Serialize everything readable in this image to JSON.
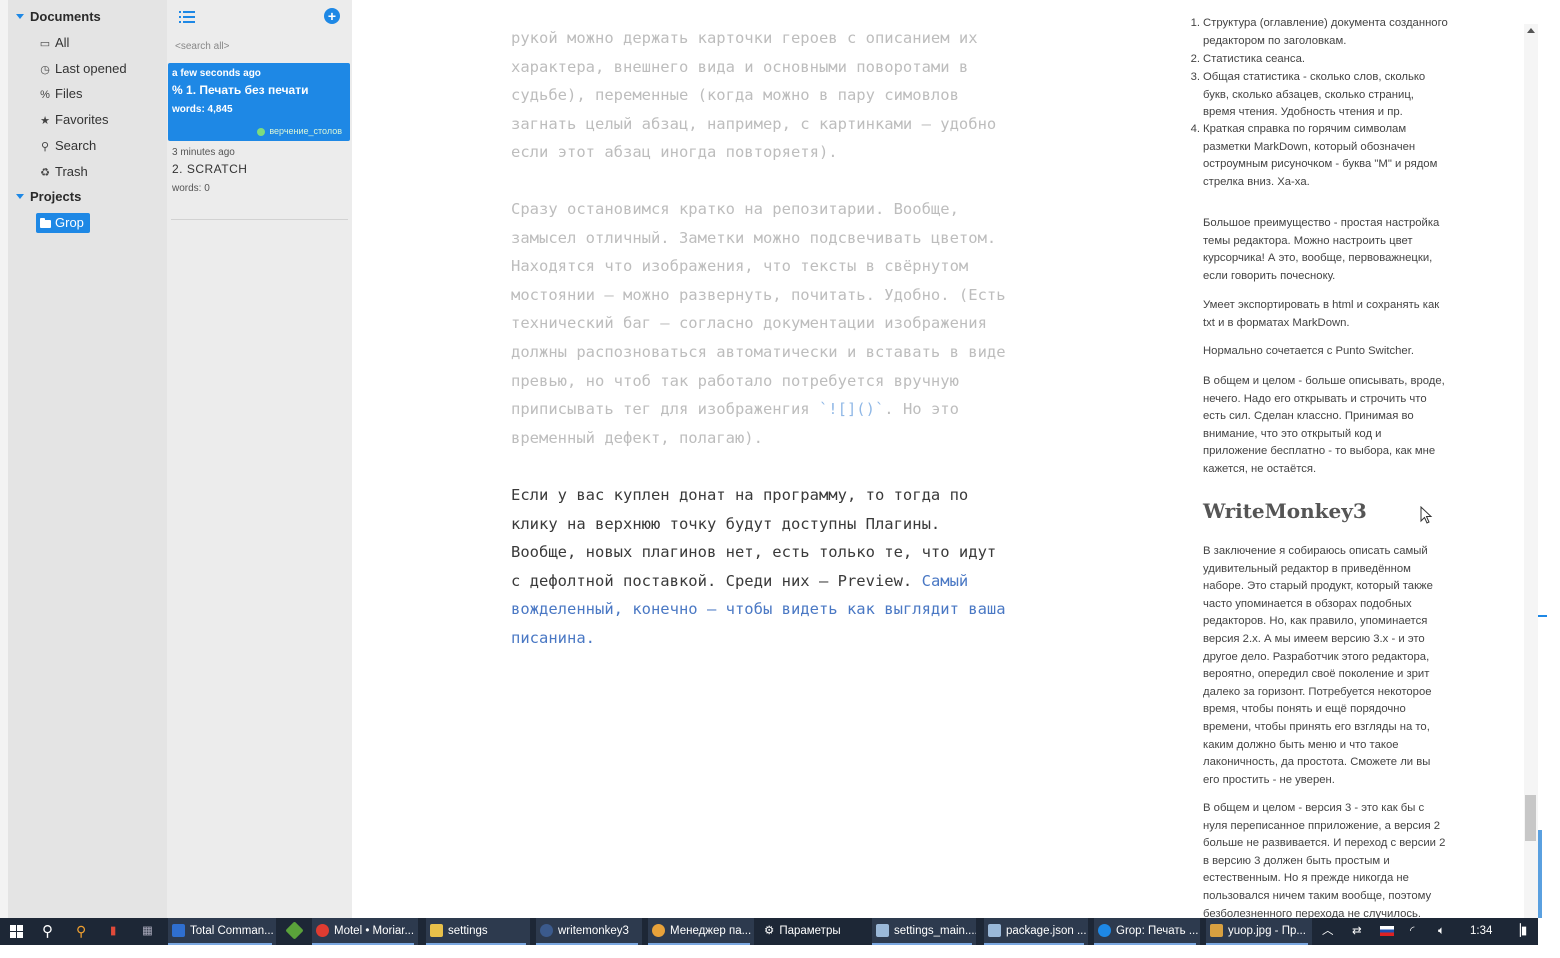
{
  "sidebar": {
    "documents_label": "Documents",
    "items": [
      {
        "label": "All",
        "icon": "inbox-icon"
      },
      {
        "label": "Last opened",
        "icon": "clock-icon"
      },
      {
        "label": "Files",
        "icon": "link-icon"
      },
      {
        "label": "Favorites",
        "icon": "star-icon"
      },
      {
        "label": "Search",
        "icon": "search-icon"
      },
      {
        "label": "Trash",
        "icon": "recycle-icon"
      }
    ],
    "projects_label": "Projects",
    "project_selected": "Grop"
  },
  "doclist": {
    "search_placeholder": "<search all>",
    "docs": [
      {
        "time": "a few seconds ago",
        "title": "1. Печать без печати",
        "words": "words: 4,845",
        "tag": "верчение_столов",
        "selected": true
      },
      {
        "time": "3 minutes ago",
        "title": "2. SCRATCH",
        "words": "words: 0",
        "selected": false
      }
    ]
  },
  "editor": {
    "p1": "рукой можно держать карточки героев с описанием их\nхарактера, внешнего вида и основными поворотами в\nсудьбе), переменные (когда можно в пару симовлов\nзагнать целый абзац, например, с картинками – удобно\nесли этот абзац иногда повторяетя).",
    "p2a": "Сразу остановимся кратко на репозитарии. Вообще,\nзамысел отличный. Заметки можно подсвечивать цветом.\nНаходятся что изображения, что тексты в свёрнутом\nмостоянии – можно развернуть, почитать. Удобно. (Есть\nтехнический баг – согласно документации изображения\nдолжны распозноваться автоматически и вставать в виде\nпревью, но чтоб так работало потребуется вручную\nприписывать тег для изображенгия ",
    "p2code": "`![]()`",
    "p2b": ". Но это",
    "p2c": "временный дефект, полагаю).",
    "p3a": "Если у вас куплен донат на программу, то тогда по\nклику на верхнюю точку будут доступны Плагины.\nВообще, новых плагинов нет, есть только те, что идут\nс дефолтной поставкой. Среди них – Preview. ",
    "p3link1": "Самый",
    "p3link2": "вожделенный, конечно – чтобы видеть как выглядит ваша\nписанина."
  },
  "preview": {
    "list": [
      {
        "num": "1.",
        "text": "Структура (оглавление) документа созданного\nредактором по заголовкам."
      },
      {
        "num": "2.",
        "text": "Статистика сеанса."
      },
      {
        "num": "3.",
        "text": "Общая статистика - сколько слов, сколько\nбукв, сколько абзацев, сколько страниц,\nвремя чтения. Удобность чтения и пр."
      },
      {
        "num": "4.",
        "text": "Краткая справка по горячим символам\nразметки MarkDown, который обозначен\nостроумным рисуночком - буква \"М\" и рядом\nстрелка вниз. Ха-ха."
      }
    ],
    "paras": [
      "Большое преимущество - простая настройка\nтемы редактора. Можно настроить цвет\nкурсорчика! А это, вообще, первоважнецки,\nесли говорить почесноку.",
      "Умеет экспортировать в html и сохранять как\ntxt и в форматах MarkDown.",
      "Нормально сочетается с Punto Switcher.",
      "В общем и целом - больше описывать, вроде,\nнечего. Надо его открывать и строчить что\nесть сил. Сделан классно. Принимая во\nвнимание, что это открытый код и\nприложение бесплатно - то выбора, как мне\nкажется, не остаётся."
    ],
    "heading": "WriteMonkey3",
    "paras2": [
      "В заключение я собираюсь описать самый\nудивительный редактор в приведённом\nнаборе. Это старый продукт, который также\nчасто упоминается в обзорах подобных\nредакторов. Но, как правило, упоминается\nверсия 2.х. А мы имеем версию 3.х - и это\nдругое дело. Разработчик этого редактора,\nвероятно, опередил своё поколение и зрит\nдалеко за горизонт. Потребуется некоторое\nвремя, чтобы понять и ещё порядочно\nвремени, чтобы принять его взгляды на то,\nкаким должно быть меню и что такое\nлаконичность, да простота. Сможете ли вы\nего простить - не уверен.",
      "В общем и целом - версия 3 - это как бы с\nнуля переписанное пприложение, а версия 2\nбольше не развивается. И переход с версии 2\nв версию 3 должен быть простым и\nестественным. Но я прежде никогда не\nпользовался ничем таким вообще, поэтому\nбезболезненного перехода не случилось."
    ]
  },
  "taskbar": {
    "apps": [
      {
        "label": "Total Comman...",
        "color": "#2f6fd0"
      },
      {
        "label": "",
        "color": "#5aa23a"
      },
      {
        "label": "Motel • Moriar...",
        "color": "#e03c31"
      },
      {
        "label": "settings",
        "color": "#e8c04a"
      },
      {
        "label": "writemonkey3",
        "color": "#3b5a8c"
      },
      {
        "label": "Менеджер па...",
        "color": "#e8a23a"
      },
      {
        "label": "Параметры",
        "color": "#cccccc"
      },
      {
        "label": "settings_main....",
        "color": "#9ab8d8"
      },
      {
        "label": "package.json ...",
        "color": "#9ab8d8"
      },
      {
        "label": "Grop: Печать ...",
        "color": "#1e88e5"
      },
      {
        "label": "yuop.jpg - Пр...",
        "color": "#d8a040"
      }
    ],
    "clock": "1:34"
  },
  "colors": {
    "accent": "#1e88e5",
    "taskbar": "#1d2736",
    "sidebar": "#e4e4e4"
  }
}
